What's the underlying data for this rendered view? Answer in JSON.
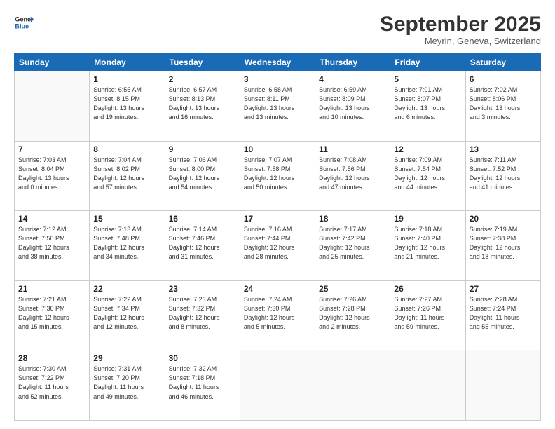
{
  "header": {
    "logo_line1": "General",
    "logo_line2": "Blue",
    "month": "September 2025",
    "location": "Meyrin, Geneva, Switzerland"
  },
  "weekdays": [
    "Sunday",
    "Monday",
    "Tuesday",
    "Wednesday",
    "Thursday",
    "Friday",
    "Saturday"
  ],
  "weeks": [
    [
      {
        "day": "",
        "info": ""
      },
      {
        "day": "1",
        "info": "Sunrise: 6:55 AM\nSunset: 8:15 PM\nDaylight: 13 hours\nand 19 minutes."
      },
      {
        "day": "2",
        "info": "Sunrise: 6:57 AM\nSunset: 8:13 PM\nDaylight: 13 hours\nand 16 minutes."
      },
      {
        "day": "3",
        "info": "Sunrise: 6:58 AM\nSunset: 8:11 PM\nDaylight: 13 hours\nand 13 minutes."
      },
      {
        "day": "4",
        "info": "Sunrise: 6:59 AM\nSunset: 8:09 PM\nDaylight: 13 hours\nand 10 minutes."
      },
      {
        "day": "5",
        "info": "Sunrise: 7:01 AM\nSunset: 8:07 PM\nDaylight: 13 hours\nand 6 minutes."
      },
      {
        "day": "6",
        "info": "Sunrise: 7:02 AM\nSunset: 8:06 PM\nDaylight: 13 hours\nand 3 minutes."
      }
    ],
    [
      {
        "day": "7",
        "info": "Sunrise: 7:03 AM\nSunset: 8:04 PM\nDaylight: 13 hours\nand 0 minutes."
      },
      {
        "day": "8",
        "info": "Sunrise: 7:04 AM\nSunset: 8:02 PM\nDaylight: 12 hours\nand 57 minutes."
      },
      {
        "day": "9",
        "info": "Sunrise: 7:06 AM\nSunset: 8:00 PM\nDaylight: 12 hours\nand 54 minutes."
      },
      {
        "day": "10",
        "info": "Sunrise: 7:07 AM\nSunset: 7:58 PM\nDaylight: 12 hours\nand 50 minutes."
      },
      {
        "day": "11",
        "info": "Sunrise: 7:08 AM\nSunset: 7:56 PM\nDaylight: 12 hours\nand 47 minutes."
      },
      {
        "day": "12",
        "info": "Sunrise: 7:09 AM\nSunset: 7:54 PM\nDaylight: 12 hours\nand 44 minutes."
      },
      {
        "day": "13",
        "info": "Sunrise: 7:11 AM\nSunset: 7:52 PM\nDaylight: 12 hours\nand 41 minutes."
      }
    ],
    [
      {
        "day": "14",
        "info": "Sunrise: 7:12 AM\nSunset: 7:50 PM\nDaylight: 12 hours\nand 38 minutes."
      },
      {
        "day": "15",
        "info": "Sunrise: 7:13 AM\nSunset: 7:48 PM\nDaylight: 12 hours\nand 34 minutes."
      },
      {
        "day": "16",
        "info": "Sunrise: 7:14 AM\nSunset: 7:46 PM\nDaylight: 12 hours\nand 31 minutes."
      },
      {
        "day": "17",
        "info": "Sunrise: 7:16 AM\nSunset: 7:44 PM\nDaylight: 12 hours\nand 28 minutes."
      },
      {
        "day": "18",
        "info": "Sunrise: 7:17 AM\nSunset: 7:42 PM\nDaylight: 12 hours\nand 25 minutes."
      },
      {
        "day": "19",
        "info": "Sunrise: 7:18 AM\nSunset: 7:40 PM\nDaylight: 12 hours\nand 21 minutes."
      },
      {
        "day": "20",
        "info": "Sunrise: 7:19 AM\nSunset: 7:38 PM\nDaylight: 12 hours\nand 18 minutes."
      }
    ],
    [
      {
        "day": "21",
        "info": "Sunrise: 7:21 AM\nSunset: 7:36 PM\nDaylight: 12 hours\nand 15 minutes."
      },
      {
        "day": "22",
        "info": "Sunrise: 7:22 AM\nSunset: 7:34 PM\nDaylight: 12 hours\nand 12 minutes."
      },
      {
        "day": "23",
        "info": "Sunrise: 7:23 AM\nSunset: 7:32 PM\nDaylight: 12 hours\nand 8 minutes."
      },
      {
        "day": "24",
        "info": "Sunrise: 7:24 AM\nSunset: 7:30 PM\nDaylight: 12 hours\nand 5 minutes."
      },
      {
        "day": "25",
        "info": "Sunrise: 7:26 AM\nSunset: 7:28 PM\nDaylight: 12 hours\nand 2 minutes."
      },
      {
        "day": "26",
        "info": "Sunrise: 7:27 AM\nSunset: 7:26 PM\nDaylight: 11 hours\nand 59 minutes."
      },
      {
        "day": "27",
        "info": "Sunrise: 7:28 AM\nSunset: 7:24 PM\nDaylight: 11 hours\nand 55 minutes."
      }
    ],
    [
      {
        "day": "28",
        "info": "Sunrise: 7:30 AM\nSunset: 7:22 PM\nDaylight: 11 hours\nand 52 minutes."
      },
      {
        "day": "29",
        "info": "Sunrise: 7:31 AM\nSunset: 7:20 PM\nDaylight: 11 hours\nand 49 minutes."
      },
      {
        "day": "30",
        "info": "Sunrise: 7:32 AM\nSunset: 7:18 PM\nDaylight: 11 hours\nand 46 minutes."
      },
      {
        "day": "",
        "info": ""
      },
      {
        "day": "",
        "info": ""
      },
      {
        "day": "",
        "info": ""
      },
      {
        "day": "",
        "info": ""
      }
    ]
  ]
}
